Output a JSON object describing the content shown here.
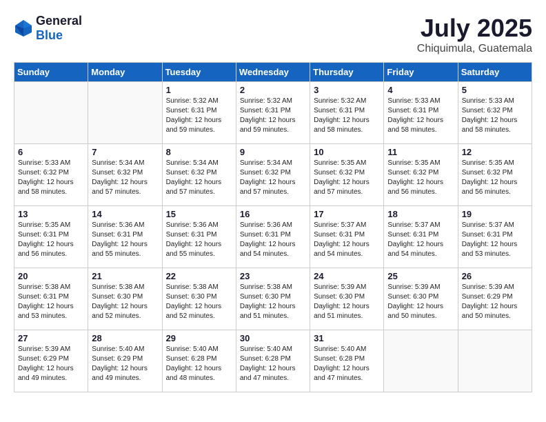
{
  "header": {
    "logo": {
      "general": "General",
      "blue": "Blue"
    },
    "month": "July 2025",
    "location": "Chiquimula, Guatemala"
  },
  "weekdays": [
    "Sunday",
    "Monday",
    "Tuesday",
    "Wednesday",
    "Thursday",
    "Friday",
    "Saturday"
  ],
  "weeks": [
    [
      {
        "day": "",
        "sunrise": "",
        "sunset": "",
        "daylight": "",
        "empty": true
      },
      {
        "day": "",
        "sunrise": "",
        "sunset": "",
        "daylight": "",
        "empty": true
      },
      {
        "day": "1",
        "sunrise": "Sunrise: 5:32 AM",
        "sunset": "Sunset: 6:31 PM",
        "daylight": "Daylight: 12 hours and 59 minutes.",
        "empty": false
      },
      {
        "day": "2",
        "sunrise": "Sunrise: 5:32 AM",
        "sunset": "Sunset: 6:31 PM",
        "daylight": "Daylight: 12 hours and 59 minutes.",
        "empty": false
      },
      {
        "day": "3",
        "sunrise": "Sunrise: 5:32 AM",
        "sunset": "Sunset: 6:31 PM",
        "daylight": "Daylight: 12 hours and 58 minutes.",
        "empty": false
      },
      {
        "day": "4",
        "sunrise": "Sunrise: 5:33 AM",
        "sunset": "Sunset: 6:31 PM",
        "daylight": "Daylight: 12 hours and 58 minutes.",
        "empty": false
      },
      {
        "day": "5",
        "sunrise": "Sunrise: 5:33 AM",
        "sunset": "Sunset: 6:32 PM",
        "daylight": "Daylight: 12 hours and 58 minutes.",
        "empty": false
      }
    ],
    [
      {
        "day": "6",
        "sunrise": "Sunrise: 5:33 AM",
        "sunset": "Sunset: 6:32 PM",
        "daylight": "Daylight: 12 hours and 58 minutes.",
        "empty": false
      },
      {
        "day": "7",
        "sunrise": "Sunrise: 5:34 AM",
        "sunset": "Sunset: 6:32 PM",
        "daylight": "Daylight: 12 hours and 57 minutes.",
        "empty": false
      },
      {
        "day": "8",
        "sunrise": "Sunrise: 5:34 AM",
        "sunset": "Sunset: 6:32 PM",
        "daylight": "Daylight: 12 hours and 57 minutes.",
        "empty": false
      },
      {
        "day": "9",
        "sunrise": "Sunrise: 5:34 AM",
        "sunset": "Sunset: 6:32 PM",
        "daylight": "Daylight: 12 hours and 57 minutes.",
        "empty": false
      },
      {
        "day": "10",
        "sunrise": "Sunrise: 5:35 AM",
        "sunset": "Sunset: 6:32 PM",
        "daylight": "Daylight: 12 hours and 57 minutes.",
        "empty": false
      },
      {
        "day": "11",
        "sunrise": "Sunrise: 5:35 AM",
        "sunset": "Sunset: 6:32 PM",
        "daylight": "Daylight: 12 hours and 56 minutes.",
        "empty": false
      },
      {
        "day": "12",
        "sunrise": "Sunrise: 5:35 AM",
        "sunset": "Sunset: 6:32 PM",
        "daylight": "Daylight: 12 hours and 56 minutes.",
        "empty": false
      }
    ],
    [
      {
        "day": "13",
        "sunrise": "Sunrise: 5:35 AM",
        "sunset": "Sunset: 6:31 PM",
        "daylight": "Daylight: 12 hours and 56 minutes.",
        "empty": false
      },
      {
        "day": "14",
        "sunrise": "Sunrise: 5:36 AM",
        "sunset": "Sunset: 6:31 PM",
        "daylight": "Daylight: 12 hours and 55 minutes.",
        "empty": false
      },
      {
        "day": "15",
        "sunrise": "Sunrise: 5:36 AM",
        "sunset": "Sunset: 6:31 PM",
        "daylight": "Daylight: 12 hours and 55 minutes.",
        "empty": false
      },
      {
        "day": "16",
        "sunrise": "Sunrise: 5:36 AM",
        "sunset": "Sunset: 6:31 PM",
        "daylight": "Daylight: 12 hours and 54 minutes.",
        "empty": false
      },
      {
        "day": "17",
        "sunrise": "Sunrise: 5:37 AM",
        "sunset": "Sunset: 6:31 PM",
        "daylight": "Daylight: 12 hours and 54 minutes.",
        "empty": false
      },
      {
        "day": "18",
        "sunrise": "Sunrise: 5:37 AM",
        "sunset": "Sunset: 6:31 PM",
        "daylight": "Daylight: 12 hours and 54 minutes.",
        "empty": false
      },
      {
        "day": "19",
        "sunrise": "Sunrise: 5:37 AM",
        "sunset": "Sunset: 6:31 PM",
        "daylight": "Daylight: 12 hours and 53 minutes.",
        "empty": false
      }
    ],
    [
      {
        "day": "20",
        "sunrise": "Sunrise: 5:38 AM",
        "sunset": "Sunset: 6:31 PM",
        "daylight": "Daylight: 12 hours and 53 minutes.",
        "empty": false
      },
      {
        "day": "21",
        "sunrise": "Sunrise: 5:38 AM",
        "sunset": "Sunset: 6:30 PM",
        "daylight": "Daylight: 12 hours and 52 minutes.",
        "empty": false
      },
      {
        "day": "22",
        "sunrise": "Sunrise: 5:38 AM",
        "sunset": "Sunset: 6:30 PM",
        "daylight": "Daylight: 12 hours and 52 minutes.",
        "empty": false
      },
      {
        "day": "23",
        "sunrise": "Sunrise: 5:38 AM",
        "sunset": "Sunset: 6:30 PM",
        "daylight": "Daylight: 12 hours and 51 minutes.",
        "empty": false
      },
      {
        "day": "24",
        "sunrise": "Sunrise: 5:39 AM",
        "sunset": "Sunset: 6:30 PM",
        "daylight": "Daylight: 12 hours and 51 minutes.",
        "empty": false
      },
      {
        "day": "25",
        "sunrise": "Sunrise: 5:39 AM",
        "sunset": "Sunset: 6:30 PM",
        "daylight": "Daylight: 12 hours and 50 minutes.",
        "empty": false
      },
      {
        "day": "26",
        "sunrise": "Sunrise: 5:39 AM",
        "sunset": "Sunset: 6:29 PM",
        "daylight": "Daylight: 12 hours and 50 minutes.",
        "empty": false
      }
    ],
    [
      {
        "day": "27",
        "sunrise": "Sunrise: 5:39 AM",
        "sunset": "Sunset: 6:29 PM",
        "daylight": "Daylight: 12 hours and 49 minutes.",
        "empty": false
      },
      {
        "day": "28",
        "sunrise": "Sunrise: 5:40 AM",
        "sunset": "Sunset: 6:29 PM",
        "daylight": "Daylight: 12 hours and 49 minutes.",
        "empty": false
      },
      {
        "day": "29",
        "sunrise": "Sunrise: 5:40 AM",
        "sunset": "Sunset: 6:28 PM",
        "daylight": "Daylight: 12 hours and 48 minutes.",
        "empty": false
      },
      {
        "day": "30",
        "sunrise": "Sunrise: 5:40 AM",
        "sunset": "Sunset: 6:28 PM",
        "daylight": "Daylight: 12 hours and 47 minutes.",
        "empty": false
      },
      {
        "day": "31",
        "sunrise": "Sunrise: 5:40 AM",
        "sunset": "Sunset: 6:28 PM",
        "daylight": "Daylight: 12 hours and 47 minutes.",
        "empty": false
      },
      {
        "day": "",
        "sunrise": "",
        "sunset": "",
        "daylight": "",
        "empty": true
      },
      {
        "day": "",
        "sunrise": "",
        "sunset": "",
        "daylight": "",
        "empty": true
      }
    ]
  ]
}
